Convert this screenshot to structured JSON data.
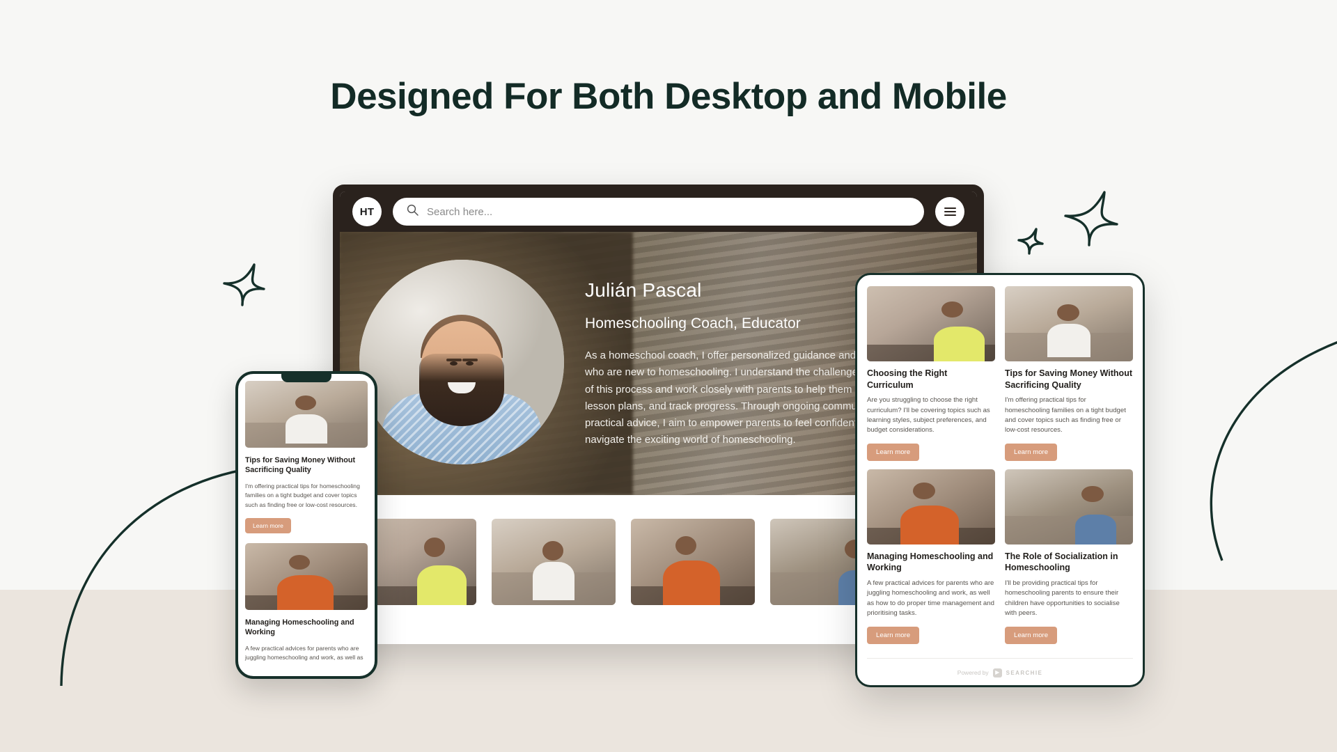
{
  "page": {
    "title": "Designed For Both Desktop and Mobile",
    "accent_color": "#d79c7c",
    "dark_green": "#132b26",
    "frame_color": "#2a221d",
    "background_color": "#f7f7f5",
    "band_color": "#ebe5de"
  },
  "desktop": {
    "header": {
      "logo_text": "HT",
      "search_placeholder": "Search here...",
      "search_icon": "search-icon",
      "menu_icon": "hamburger-menu-icon"
    },
    "hero": {
      "name": "Julián Pascal",
      "role": "Homeschooling Coach, Educator",
      "description": "As a homeschool coach, I offer personalized guidance and support to parents who are new to homeschooling. I understand the challenges and complexities of this process and work closely with parents to help them set goals, develop lesson plans, and track progress. Through ongoing communication and practical advice, I aim to empower parents to feel confident and capable as they navigate the exciting world of homeschooling."
    },
    "strip_images": [
      "mother-and-son-studying",
      "girl-reading-on-sofa",
      "boy-with-headphones-at-desk",
      "children-playing-with-blocks"
    ]
  },
  "tablet": {
    "cards": [
      {
        "image": "mother-and-son-studying",
        "title": "Choosing the Right Curriculum",
        "description": "Are you struggling to choose the right curriculum? I'll be covering topics such as learning styles, subject preferences, and budget considerations.",
        "button": "Learn more"
      },
      {
        "image": "girl-reading-on-sofa",
        "title": "Tips for Saving Money Without Sacrificing Quality",
        "description": "I'm offering practical tips for homeschooling families on a tight budget and cover topics such as finding free or low-cost resources.",
        "button": "Learn more"
      },
      {
        "image": "boy-with-headphones-at-desk",
        "title": "Managing Homeschooling and Working",
        "description": "A few practical advices for parents who are juggling homeschooling and work, as well as how to do proper time management and prioritising tasks.",
        "button": "Learn more"
      },
      {
        "image": "children-playing-with-blocks",
        "title": "The Role of Socialization in Homeschooling",
        "description": "I'll be providing practical tips for homeschooling parents to ensure their children have opportunities to socialise with peers.",
        "button": "Learn more"
      }
    ],
    "footer": {
      "powered_by": "Powered by",
      "brand": "SEARCHIE",
      "logo_icon": "searchie-logo-icon"
    }
  },
  "phone": {
    "cards": [
      {
        "image": "girl-reading-on-sofa",
        "title": "Tips for Saving Money Without Sacrificing Quality",
        "description": "I'm offering practical tips for homeschooling families on a tight budget and cover topics such as finding free or low-cost resources.",
        "button": "Learn more"
      },
      {
        "image": "boy-with-headphones-at-desk",
        "title": "Managing Homeschooling and Working",
        "description": "A few practical advices for parents who are juggling homeschooling and work, as well as",
        "button": "Learn more"
      }
    ]
  },
  "decorations": {
    "sparkle_large": "sparkle-icon",
    "sparkle_small": "sparkle-icon",
    "sparkle_right": "sparkle-icon",
    "swoosh_left": "curved-line-decoration",
    "swoosh_right": "curved-line-decoration"
  }
}
